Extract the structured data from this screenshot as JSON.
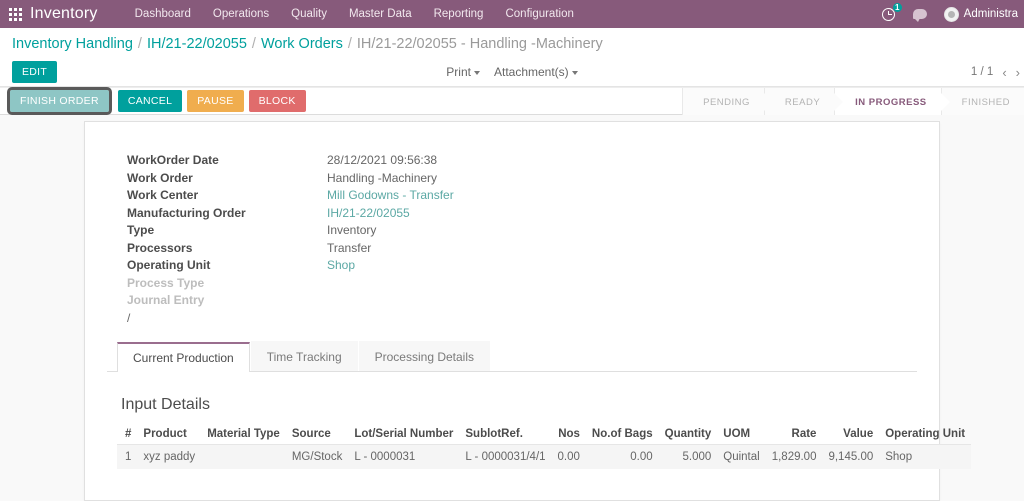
{
  "navbar": {
    "apps_icon": "apps-grid-icon",
    "brand": "Inventory",
    "menu": [
      {
        "label": "Dashboard"
      },
      {
        "label": "Operations"
      },
      {
        "label": "Quality"
      },
      {
        "label": "Master Data"
      },
      {
        "label": "Reporting"
      },
      {
        "label": "Configuration"
      }
    ],
    "activity_icon": "clock-icon",
    "activity_count": "1",
    "messaging_icon": "chat-bubble-icon",
    "avatar_icon": "user-avatar-icon",
    "user_name": "Administra",
    "brand_color": "#875a7b"
  },
  "breadcrumb": {
    "items": [
      {
        "label": "Inventory Handling",
        "type": "link"
      },
      {
        "label": "IH/21-22/02055",
        "type": "link"
      },
      {
        "label": "Work Orders",
        "type": "link"
      },
      {
        "label": "IH/21-22/02055 - Handling -Machinery",
        "type": "current"
      }
    ],
    "separator": "/"
  },
  "toolbar": {
    "edit_label": "EDIT",
    "print_label": "Print",
    "attachments_label": "Attachment(s)",
    "pager_text": "1 / 1",
    "pager_prev": "‹",
    "pager_next": "›"
  },
  "workflow": {
    "buttons": [
      {
        "label": "FINISH ORDER",
        "style": "finish",
        "focused": true
      },
      {
        "label": "CANCEL",
        "style": "cancel",
        "focused": false
      },
      {
        "label": "PAUSE",
        "style": "pause",
        "focused": false
      },
      {
        "label": "BLOCK",
        "style": "block",
        "focused": false
      }
    ],
    "statuses": [
      {
        "label": "PENDING",
        "active": false
      },
      {
        "label": "READY",
        "active": false
      },
      {
        "label": "IN PROGRESS",
        "active": true
      },
      {
        "label": "FINISHED",
        "active": false
      }
    ],
    "active_color": "#875a7b"
  },
  "form": {
    "fields": [
      {
        "label": "WorkOrder Date",
        "value": "28/12/2021 09:56:38",
        "link": false,
        "muted": false
      },
      {
        "label": "Work Order",
        "value": "Handling -Machinery",
        "link": false,
        "muted": false
      },
      {
        "label": "Work Center",
        "value": "Mill Godowns - Transfer",
        "link": true,
        "muted": false
      },
      {
        "label": "Manufacturing Order",
        "value": "IH/21-22/02055",
        "link": true,
        "muted": false
      },
      {
        "label": "Type",
        "value": "Inventory",
        "link": false,
        "muted": false
      },
      {
        "label": "Processors",
        "value": "Transfer",
        "link": false,
        "muted": false
      },
      {
        "label": "Operating Unit",
        "value": "Shop",
        "link": true,
        "muted": false
      },
      {
        "label": "Process Type",
        "value": "",
        "link": false,
        "muted": true
      },
      {
        "label": "Journal Entry",
        "value": "",
        "link": false,
        "muted": true
      }
    ],
    "trailing_text": "/"
  },
  "notebook": {
    "tabs": [
      {
        "label": "Current Production",
        "active": true
      },
      {
        "label": "Time Tracking",
        "active": false
      },
      {
        "label": "Processing Details",
        "active": false
      }
    ]
  },
  "input_details": {
    "title": "Input Details",
    "columns": [
      {
        "label": "#",
        "align": "idx"
      },
      {
        "label": "Product",
        "align": "left"
      },
      {
        "label": "Material Type",
        "align": "left"
      },
      {
        "label": "Source",
        "align": "left"
      },
      {
        "label": "Lot/Serial Number",
        "align": "left"
      },
      {
        "label": "SublotRef.",
        "align": "left"
      },
      {
        "label": "Nos",
        "align": "num"
      },
      {
        "label": "No.of Bags",
        "align": "num"
      },
      {
        "label": "Quantity",
        "align": "num"
      },
      {
        "label": "UOM",
        "align": "left"
      },
      {
        "label": "Rate",
        "align": "num"
      },
      {
        "label": "Value",
        "align": "num"
      },
      {
        "label": "Operating Unit",
        "align": "left"
      }
    ],
    "rows": [
      {
        "index": "1",
        "product": "xyz paddy",
        "material_type": "",
        "source": "MG/Stock",
        "lot_serial_number": "L - 0000031",
        "sublot_ref": "L - 0000031/4/1",
        "nos": "0.00",
        "no_of_bags": "0.00",
        "quantity": "5.000",
        "uom": "Quintal",
        "rate": "1,829.00",
        "value": "9,145.00",
        "operating_unit": "Shop"
      }
    ]
  }
}
